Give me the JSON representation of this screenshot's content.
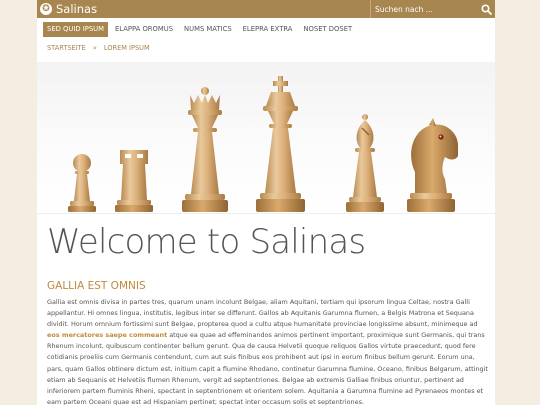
{
  "header": {
    "logo_text": "Salinas",
    "search_placeholder": "Suchen nach ..."
  },
  "nav": {
    "items": [
      {
        "label": "SED QUID IPSUM",
        "active": true
      },
      {
        "label": "ELAPPA OROMUS",
        "active": false
      },
      {
        "label": "NUMS MATICS",
        "active": false
      },
      {
        "label": "ELEPRA EXTRA",
        "active": false
      },
      {
        "label": "NOSET DOSET",
        "active": false
      }
    ]
  },
  "breadcrumb": {
    "home": "STARTSEITE",
    "separator": "»",
    "current": "LOREM IPSUM"
  },
  "hero": {
    "pieces": [
      "pawn",
      "rook",
      "queen",
      "king",
      "bishop",
      "knight"
    ]
  },
  "main": {
    "title": "Welcome to Salinas",
    "section_title": "GALLIA EST OMNIS",
    "paragraph_before": "Gallia est omnis divisa in partes tres, quarum unam incolunt Belgae, aliam Aquitani, tertiam qui ipsorum lingua Celtae, nostra Galli appellantur. Hi omnes lingua, institutis, legibus inter se differunt. Gallos ab Aquitanis Garumna flumen, a Belgis Matrona et Sequana dividit. Horum omnium fortissimi sunt Belgae, propterea quod a cultu atque humanitate provinciae longissime absunt, minimeque ad ",
    "paragraph_highlight": "eos mercatores saepe commeant",
    "paragraph_after": " atque ea quae ad effeminandos animos pertinent important, proximique sunt Germanis, qui trans Rhenum incolunt, quibuscum continenter bellum gerunt. Qua de causa Helvetii quoque reliquos Gallos virtute praecedunt, quod fere cotidianis proeliis cum Germanis contendunt, cum aut suis finibus eos prohibent aut ipsi in eorum finibus bellum gerunt. Eorum una, pars, quam Gallos obtinere dictum est, initium capit a flumine Rhodano, continetur Garumna flumine, Oceano, finibus Belgarum, attingit etiam ab Sequanis et Helvetiis flumen Rhenum, vergit ad septentriones. Belgae ab extremis Galliae finibus oriuntur, pertinent ad inferiorem partem fluminis Rheni, spectant in septentrionem et orientem solem. Aquitania a Garumna flumine ad Pyrenaeos montes et eam partem Oceani quae est ad Hispaniam pertinet; spectat inter occasum solis et septentriones."
  },
  "colors": {
    "accent": "#a8864f",
    "heading": "#c08a3e",
    "page_bg": "#f5ede2"
  }
}
